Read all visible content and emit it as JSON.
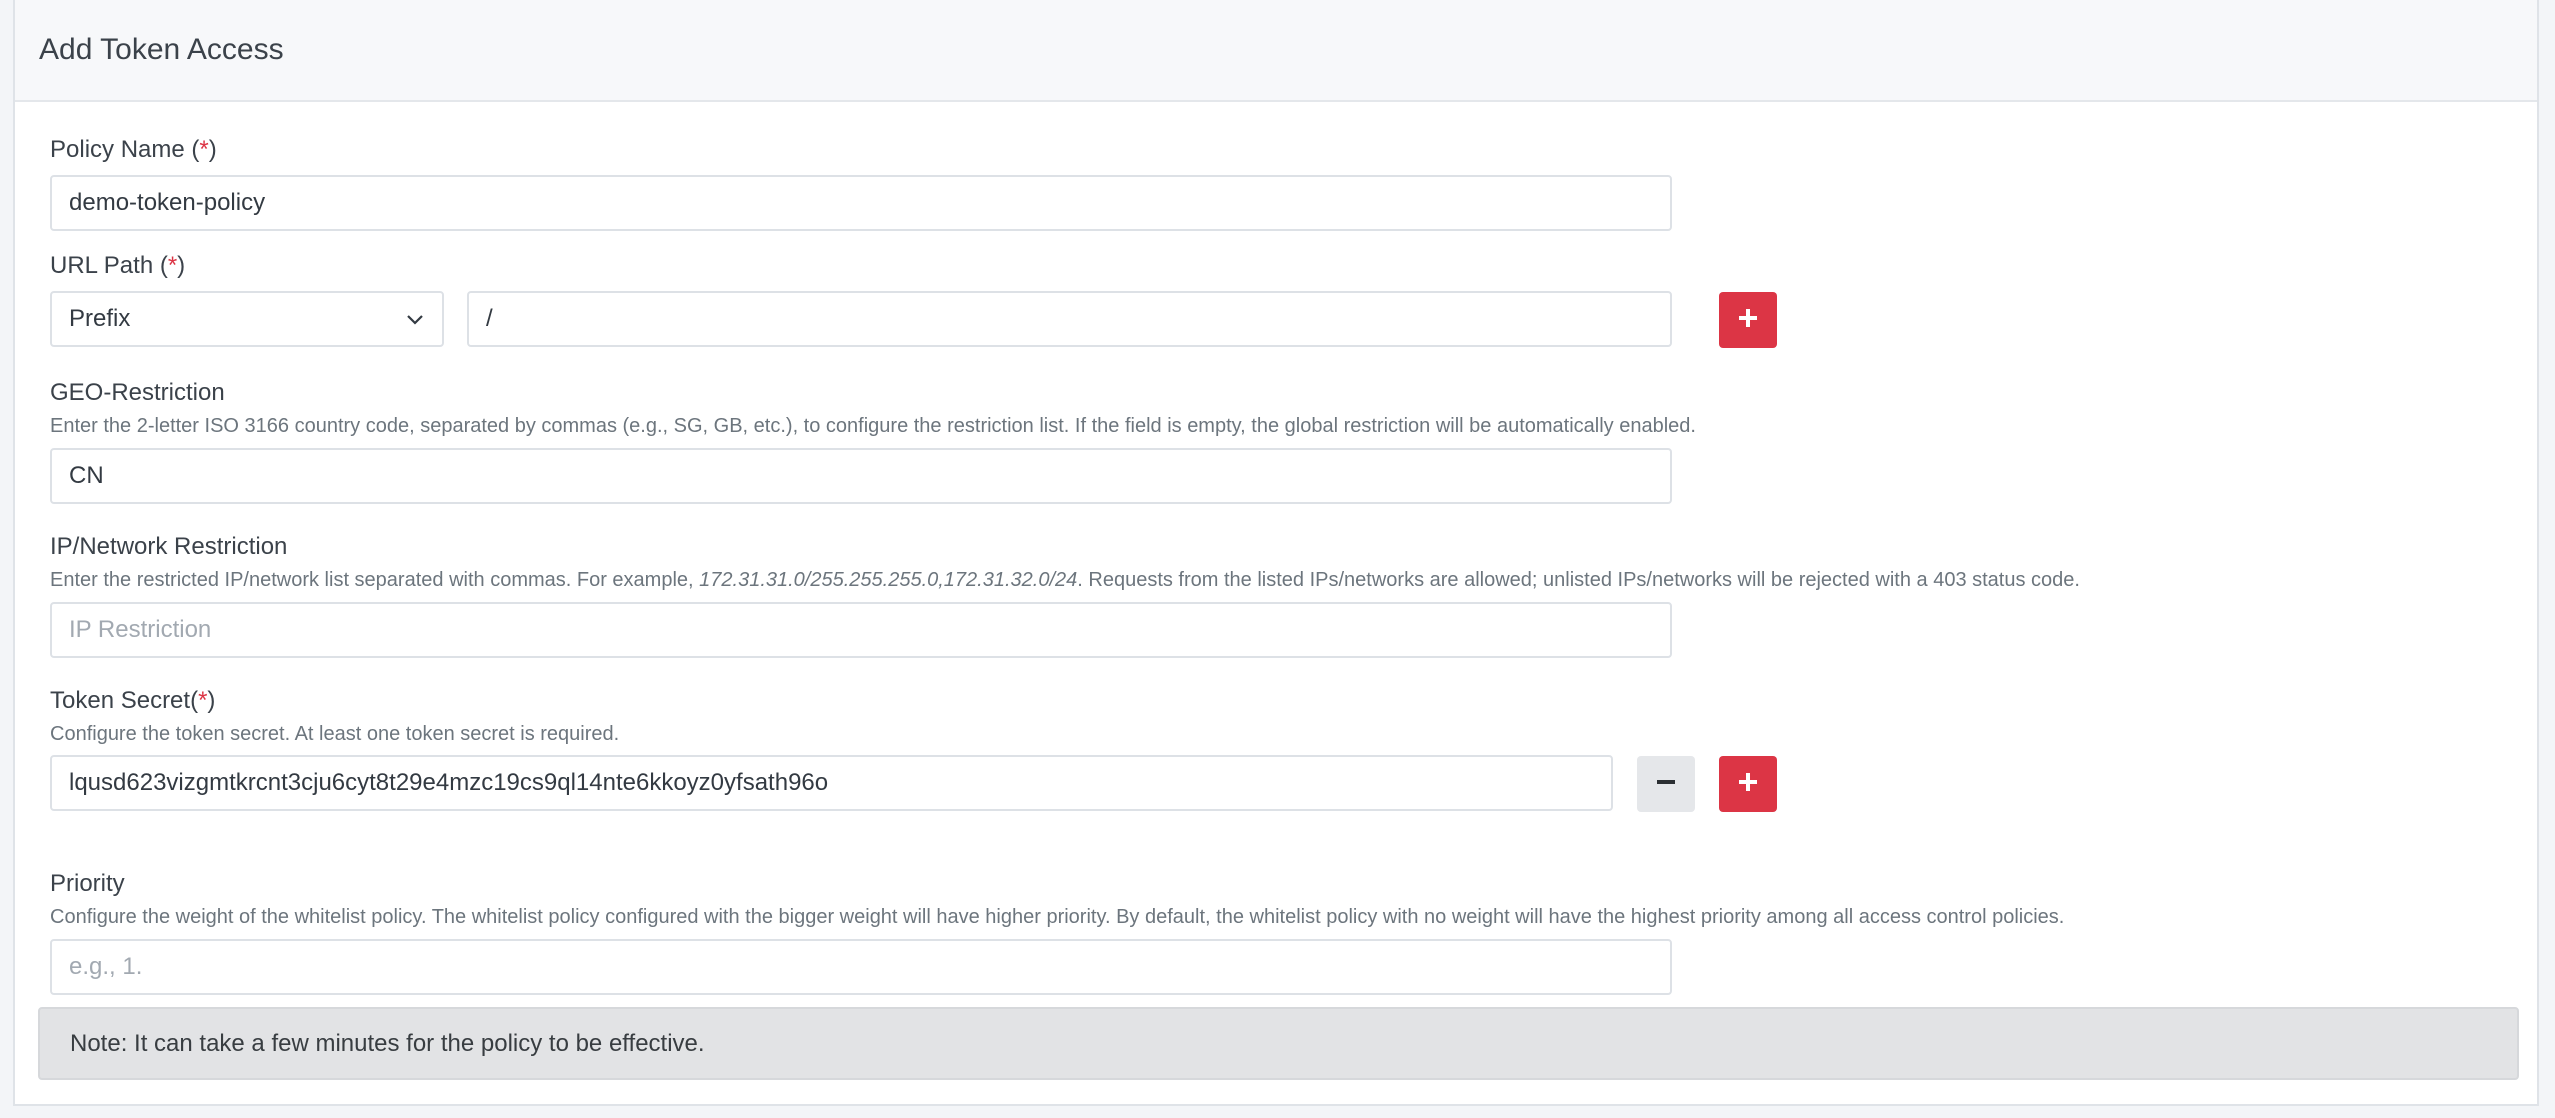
{
  "header": {
    "title": "Add Token Access"
  },
  "form": {
    "policy_name": {
      "label": "Policy Name (",
      "required_mark": "*",
      "label_close": ")",
      "value": "demo-token-policy"
    },
    "url_path": {
      "label": "URL Path (",
      "required_mark": "*",
      "label_close": ")",
      "match_type": "Prefix",
      "value": "/"
    },
    "geo_restriction": {
      "label": "GEO-Restriction",
      "help": "Enter the 2-letter ISO 3166 country code, separated by commas (e.g., SG, GB, etc.), to configure the restriction list. If the field is empty, the global restriction will be automatically enabled.",
      "value": "CN"
    },
    "ip_restriction": {
      "label": "IP/Network Restriction",
      "help_before": "Enter the restricted IP/network list separated with commas. For example, ",
      "help_example": "172.31.31.0/255.255.255.0,172.31.32.0/24",
      "help_after": ". Requests from the listed IPs/networks are allowed; unlisted IPs/networks will be rejected with a 403 status code.",
      "value": "",
      "placeholder": "IP Restriction"
    },
    "token_secret": {
      "label": "Token Secret(",
      "required_mark": "*",
      "label_close": ")",
      "help": "Configure the token secret. At least one token secret is required.",
      "value": "lqusd623vizgmtkrcnt3cju6cyt8t29e4mzc19cs9ql14nte6kkoyz0yfsath96o"
    },
    "priority": {
      "label": "Priority",
      "help": "Configure the weight of the whitelist policy. The whitelist policy configured with the bigger weight will have higher priority. By default, the whitelist policy with no weight will have the highest priority among all access control policies.",
      "value": "",
      "placeholder": "e.g., 1."
    }
  },
  "note": {
    "text": "Note: It can take a few minutes for the policy to be effective."
  },
  "icons": {
    "add": "plus-icon",
    "remove": "minus-icon",
    "dropdown": "chevron-down-icon"
  },
  "colors": {
    "accent": "#dc3545",
    "remove_button": "#e5e7ea",
    "note_background": "#e2e3e5"
  }
}
